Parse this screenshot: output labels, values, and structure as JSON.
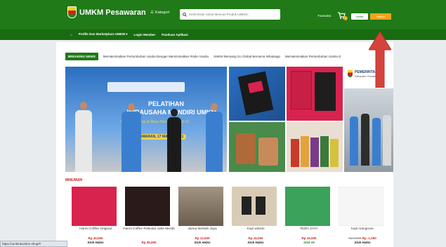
{
  "header": {
    "brand": "UMKM Pesawaran",
    "kategori_label": "Kategori",
    "search_placeholder": "Ketik Disini Untuk Mencari Produk UMKM...",
    "transaksi_label": "Transaksi",
    "cart_count": "0",
    "daftar_label": "Daftar",
    "masuk_label": "Masuk"
  },
  "nav": {
    "items": [
      "Profile Dan Marketplace UMKM",
      "Login Member",
      "Panduan Aplikasi"
    ]
  },
  "ticker": {
    "label": "BREAKING NEWS",
    "items": [
      "Memaksimalkan Pertumbuhan Usaha Dengan Meminimalkan Risiko Usaha",
      "UMKM Bersaing Go Global Bersama Whatsapp",
      "Memaksimalkan Pertumbuhan Usaha D"
    ]
  },
  "banner": {
    "title_line1": "PELATIHAN",
    "title_line2": "WIRAUSAHA MANDIRI UMKM",
    "subtitle": "Strategi Dagang di Masa Pandemi Covid-19",
    "date": "PESAWARAN, 17 MARET 2021"
  },
  "side_panel": {
    "title": "PEMERINTAH",
    "subtitle": "Kabupaten Pesawaran"
  },
  "section": {
    "title": "MINUMAN"
  },
  "products": [
    {
      "name": "Hanni Coffee Original",
      "price": "Rp 30,000",
      "stock": "Stok Habis",
      "color": "#d8234f"
    },
    {
      "name": "Hanni Coffee Robusta Jahe Merah",
      "price": "Rp 35,000",
      "stock": "",
      "color": "#2a1a1a"
    },
    {
      "name": "Jamur Berkah Jaya",
      "price": "Rp 12,000",
      "stock": "Stok Habis",
      "color": "#8a7a66"
    },
    {
      "name": "Kopi wdodo",
      "price": "Rp 15,000",
      "stock": "Stok Habis",
      "color": "#c7b39a"
    },
    {
      "name": "RIZKI JAYA",
      "price": "Rp 15,000",
      "stock": "Stok 50",
      "color": "#3aa25a"
    },
    {
      "name": "kopi mangrove",
      "price_old": "Rp 2,000",
      "price": "Rp -1,000",
      "stock": "Stok Habis",
      "color": "#f4f4f4"
    }
  ],
  "status_url": "https://umkmkumkm.shop/#"
}
